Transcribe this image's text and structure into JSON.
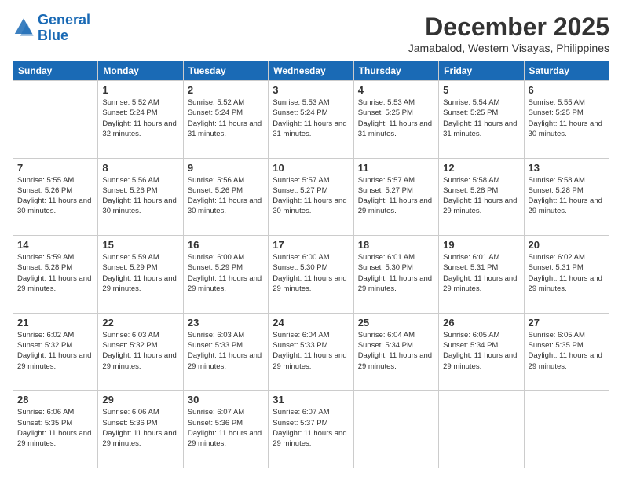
{
  "header": {
    "logo_line1": "General",
    "logo_line2": "Blue",
    "month": "December 2025",
    "location": "Jamabalod, Western Visayas, Philippines"
  },
  "weekdays": [
    "Sunday",
    "Monday",
    "Tuesday",
    "Wednesday",
    "Thursday",
    "Friday",
    "Saturday"
  ],
  "weeks": [
    [
      {
        "day": "",
        "sunrise": "",
        "sunset": "",
        "daylight": ""
      },
      {
        "day": "1",
        "sunrise": "Sunrise: 5:52 AM",
        "sunset": "Sunset: 5:24 PM",
        "daylight": "Daylight: 11 hours and 32 minutes."
      },
      {
        "day": "2",
        "sunrise": "Sunrise: 5:52 AM",
        "sunset": "Sunset: 5:24 PM",
        "daylight": "Daylight: 11 hours and 31 minutes."
      },
      {
        "day": "3",
        "sunrise": "Sunrise: 5:53 AM",
        "sunset": "Sunset: 5:24 PM",
        "daylight": "Daylight: 11 hours and 31 minutes."
      },
      {
        "day": "4",
        "sunrise": "Sunrise: 5:53 AM",
        "sunset": "Sunset: 5:25 PM",
        "daylight": "Daylight: 11 hours and 31 minutes."
      },
      {
        "day": "5",
        "sunrise": "Sunrise: 5:54 AM",
        "sunset": "Sunset: 5:25 PM",
        "daylight": "Daylight: 11 hours and 31 minutes."
      },
      {
        "day": "6",
        "sunrise": "Sunrise: 5:55 AM",
        "sunset": "Sunset: 5:25 PM",
        "daylight": "Daylight: 11 hours and 30 minutes."
      }
    ],
    [
      {
        "day": "7",
        "sunrise": "Sunrise: 5:55 AM",
        "sunset": "Sunset: 5:26 PM",
        "daylight": "Daylight: 11 hours and 30 minutes."
      },
      {
        "day": "8",
        "sunrise": "Sunrise: 5:56 AM",
        "sunset": "Sunset: 5:26 PM",
        "daylight": "Daylight: 11 hours and 30 minutes."
      },
      {
        "day": "9",
        "sunrise": "Sunrise: 5:56 AM",
        "sunset": "Sunset: 5:26 PM",
        "daylight": "Daylight: 11 hours and 30 minutes."
      },
      {
        "day": "10",
        "sunrise": "Sunrise: 5:57 AM",
        "sunset": "Sunset: 5:27 PM",
        "daylight": "Daylight: 11 hours and 30 minutes."
      },
      {
        "day": "11",
        "sunrise": "Sunrise: 5:57 AM",
        "sunset": "Sunset: 5:27 PM",
        "daylight": "Daylight: 11 hours and 29 minutes."
      },
      {
        "day": "12",
        "sunrise": "Sunrise: 5:58 AM",
        "sunset": "Sunset: 5:28 PM",
        "daylight": "Daylight: 11 hours and 29 minutes."
      },
      {
        "day": "13",
        "sunrise": "Sunrise: 5:58 AM",
        "sunset": "Sunset: 5:28 PM",
        "daylight": "Daylight: 11 hours and 29 minutes."
      }
    ],
    [
      {
        "day": "14",
        "sunrise": "Sunrise: 5:59 AM",
        "sunset": "Sunset: 5:28 PM",
        "daylight": "Daylight: 11 hours and 29 minutes."
      },
      {
        "day": "15",
        "sunrise": "Sunrise: 5:59 AM",
        "sunset": "Sunset: 5:29 PM",
        "daylight": "Daylight: 11 hours and 29 minutes."
      },
      {
        "day": "16",
        "sunrise": "Sunrise: 6:00 AM",
        "sunset": "Sunset: 5:29 PM",
        "daylight": "Daylight: 11 hours and 29 minutes."
      },
      {
        "day": "17",
        "sunrise": "Sunrise: 6:00 AM",
        "sunset": "Sunset: 5:30 PM",
        "daylight": "Daylight: 11 hours and 29 minutes."
      },
      {
        "day": "18",
        "sunrise": "Sunrise: 6:01 AM",
        "sunset": "Sunset: 5:30 PM",
        "daylight": "Daylight: 11 hours and 29 minutes."
      },
      {
        "day": "19",
        "sunrise": "Sunrise: 6:01 AM",
        "sunset": "Sunset: 5:31 PM",
        "daylight": "Daylight: 11 hours and 29 minutes."
      },
      {
        "day": "20",
        "sunrise": "Sunrise: 6:02 AM",
        "sunset": "Sunset: 5:31 PM",
        "daylight": "Daylight: 11 hours and 29 minutes."
      }
    ],
    [
      {
        "day": "21",
        "sunrise": "Sunrise: 6:02 AM",
        "sunset": "Sunset: 5:32 PM",
        "daylight": "Daylight: 11 hours and 29 minutes."
      },
      {
        "day": "22",
        "sunrise": "Sunrise: 6:03 AM",
        "sunset": "Sunset: 5:32 PM",
        "daylight": "Daylight: 11 hours and 29 minutes."
      },
      {
        "day": "23",
        "sunrise": "Sunrise: 6:03 AM",
        "sunset": "Sunset: 5:33 PM",
        "daylight": "Daylight: 11 hours and 29 minutes."
      },
      {
        "day": "24",
        "sunrise": "Sunrise: 6:04 AM",
        "sunset": "Sunset: 5:33 PM",
        "daylight": "Daylight: 11 hours and 29 minutes."
      },
      {
        "day": "25",
        "sunrise": "Sunrise: 6:04 AM",
        "sunset": "Sunset: 5:34 PM",
        "daylight": "Daylight: 11 hours and 29 minutes."
      },
      {
        "day": "26",
        "sunrise": "Sunrise: 6:05 AM",
        "sunset": "Sunset: 5:34 PM",
        "daylight": "Daylight: 11 hours and 29 minutes."
      },
      {
        "day": "27",
        "sunrise": "Sunrise: 6:05 AM",
        "sunset": "Sunset: 5:35 PM",
        "daylight": "Daylight: 11 hours and 29 minutes."
      }
    ],
    [
      {
        "day": "28",
        "sunrise": "Sunrise: 6:06 AM",
        "sunset": "Sunset: 5:35 PM",
        "daylight": "Daylight: 11 hours and 29 minutes."
      },
      {
        "day": "29",
        "sunrise": "Sunrise: 6:06 AM",
        "sunset": "Sunset: 5:36 PM",
        "daylight": "Daylight: 11 hours and 29 minutes."
      },
      {
        "day": "30",
        "sunrise": "Sunrise: 6:07 AM",
        "sunset": "Sunset: 5:36 PM",
        "daylight": "Daylight: 11 hours and 29 minutes."
      },
      {
        "day": "31",
        "sunrise": "Sunrise: 6:07 AM",
        "sunset": "Sunset: 5:37 PM",
        "daylight": "Daylight: 11 hours and 29 minutes."
      },
      {
        "day": "",
        "sunrise": "",
        "sunset": "",
        "daylight": ""
      },
      {
        "day": "",
        "sunrise": "",
        "sunset": "",
        "daylight": ""
      },
      {
        "day": "",
        "sunrise": "",
        "sunset": "",
        "daylight": ""
      }
    ]
  ]
}
